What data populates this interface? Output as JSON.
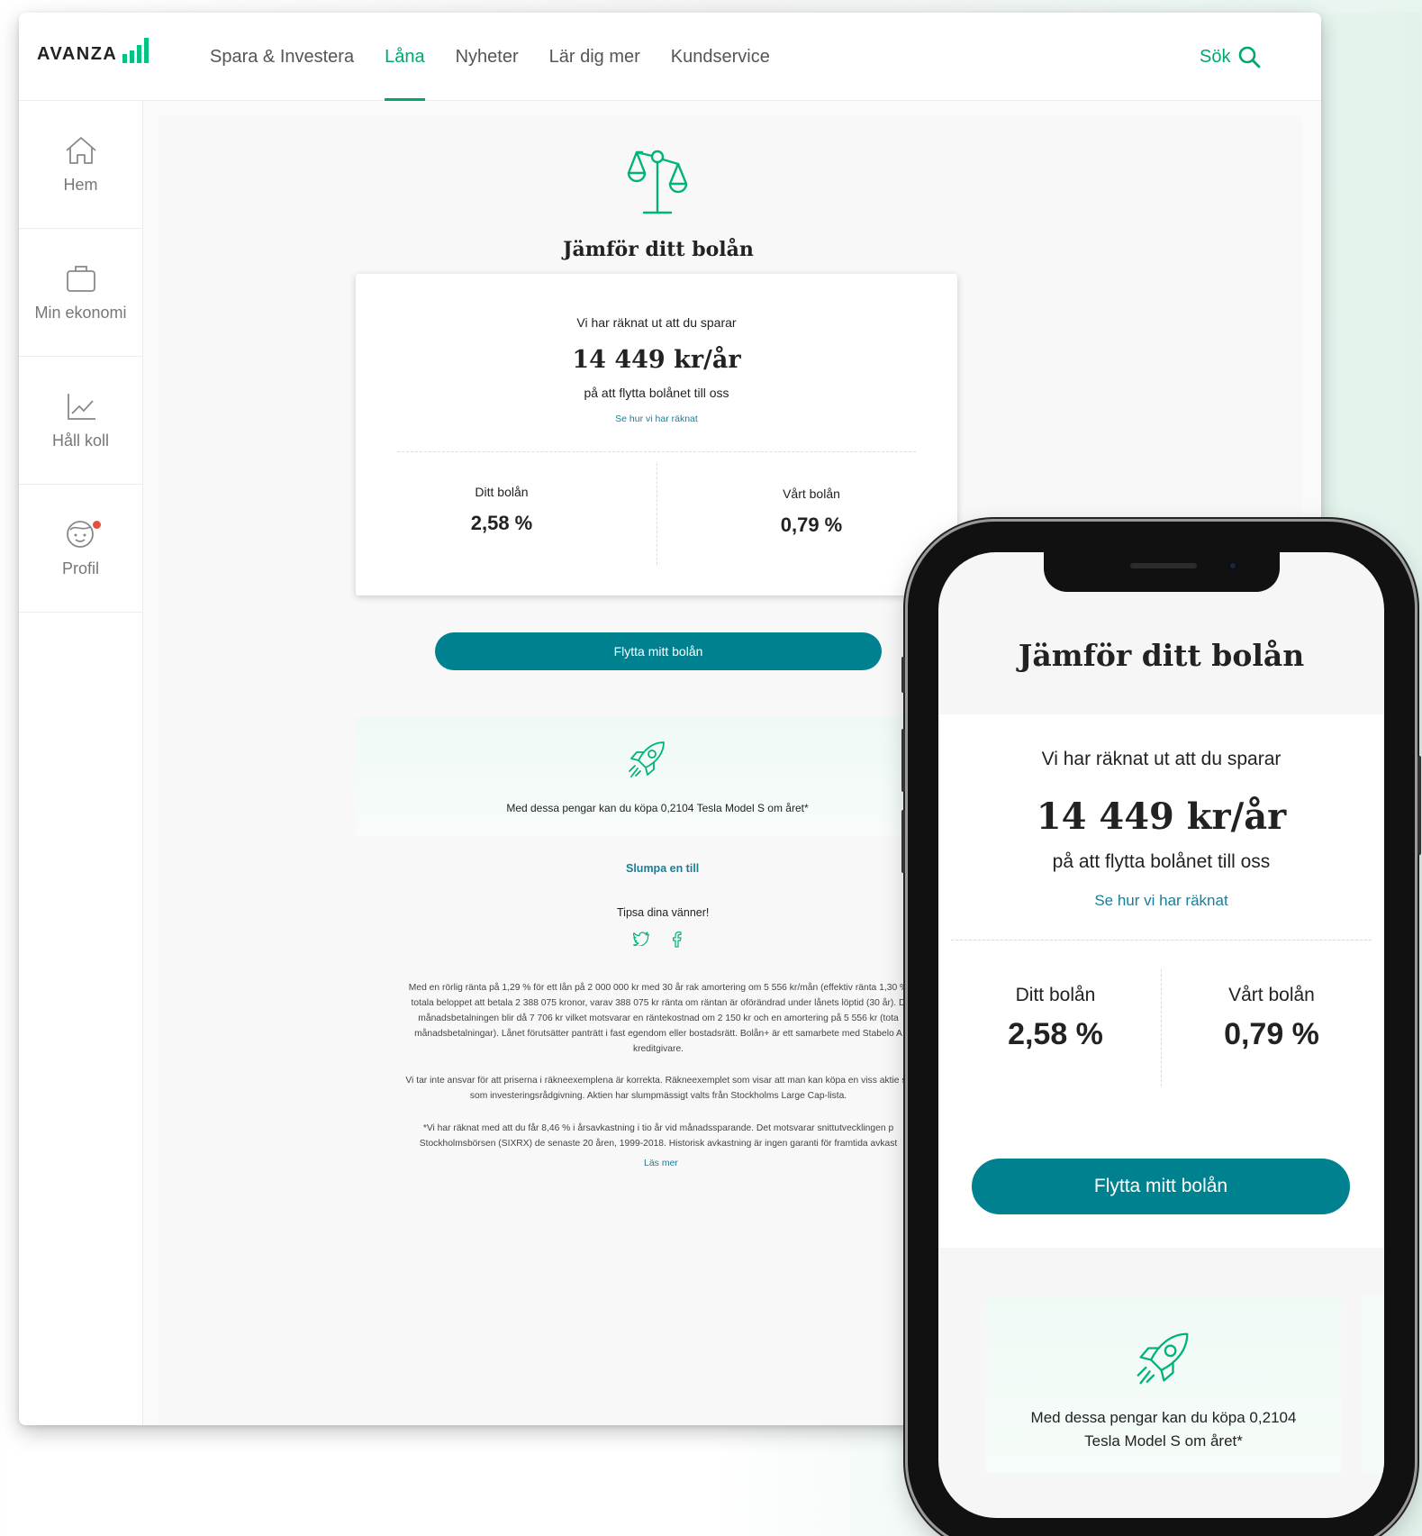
{
  "brand": {
    "name": "AVANZA",
    "accent_color": "#00a870",
    "button_color": "#00818f",
    "link_color": "#1a7e9a"
  },
  "nav": {
    "items": [
      {
        "label": "Spara & Investera",
        "active": false
      },
      {
        "label": "Låna",
        "active": true
      },
      {
        "label": "Nyheter",
        "active": false
      },
      {
        "label": "Lär dig mer",
        "active": false
      },
      {
        "label": "Kundservice",
        "active": false
      }
    ],
    "search_label": "Sök",
    "search_icon": "search-icon"
  },
  "sidebar": {
    "items": [
      {
        "label": "Hem",
        "icon": "home-icon"
      },
      {
        "label": "Min ekonomi",
        "icon": "briefcase-icon"
      },
      {
        "label": "Håll koll",
        "icon": "chart-icon"
      },
      {
        "label": "Profil",
        "icon": "profile-icon",
        "has_notification": true
      }
    ]
  },
  "compare": {
    "title": "Jämför ditt bolån",
    "intro": "Vi har räknat ut att du sparar",
    "savings": "14 449 kr/år",
    "outro": "på att flytta bolånet till oss",
    "calc_link": "Se hur vi har räknat",
    "your_loan_label": "Ditt bolån",
    "your_loan_rate": "2,58 %",
    "our_loan_label": "Vårt bolån",
    "our_loan_rate": "0,79 %",
    "cta": "Flytta mitt bolån"
  },
  "promo": {
    "text": "Med dessa pengar kan du köpa 0,2104 Tesla Model S om året*",
    "random_link": "Slumpa en till"
  },
  "share": {
    "label": "Tipsa dina vänner!",
    "icons": [
      "twitter-icon",
      "facebook-icon"
    ]
  },
  "disclaimer": {
    "lines_p1": [
      "Med en rörlig ränta på 1,29 % för ett lån på 2 000 000 kr med 30 år rak amortering om 5 556 kr/mån (effektiv ränta 1,30 %",
      "totala beloppet att betala 2 388 075 kronor, varav 388 075 kr ränta om räntan är oförändrad under lånets löptid (30 år). D",
      "månadsbetalningen blir då 7 706 kr vilket motsvarar en räntekostnad om 2 150 kr och en amortering på 5 556 kr (tota",
      "månadsbetalningar). Lånet förutsätter panträtt i fast egendom eller bostadsrätt. Bolån+ är ett samarbete med Stabelo A",
      "kreditgivare."
    ],
    "lines_p2": [
      "Vi tar inte ansvar för att priserna i räkneexemplena är korrekta. Räkneexemplet som visar att man kan köpa en viss aktie sk",
      "som investeringsrådgivning. Aktien har slumpmässigt valts från Stockholms Large Cap-lista."
    ],
    "lines_p3": [
      "*Vi har räknat med att du får 8,46 % i årsavkastning i tio år vid månadssparande. Det motsvarar snittutvecklingen p",
      "Stockholmsbörsen (SIXRX) de senaste 20 åren, 1999-2018. Historisk avkastning är ingen garanti för framtida avkast"
    ],
    "read_more": "Läs mer"
  },
  "mobile": {
    "promo_line1": "Med dessa pengar kan du köpa 0,2104",
    "promo_line2": "Tesla Model S om året*"
  }
}
